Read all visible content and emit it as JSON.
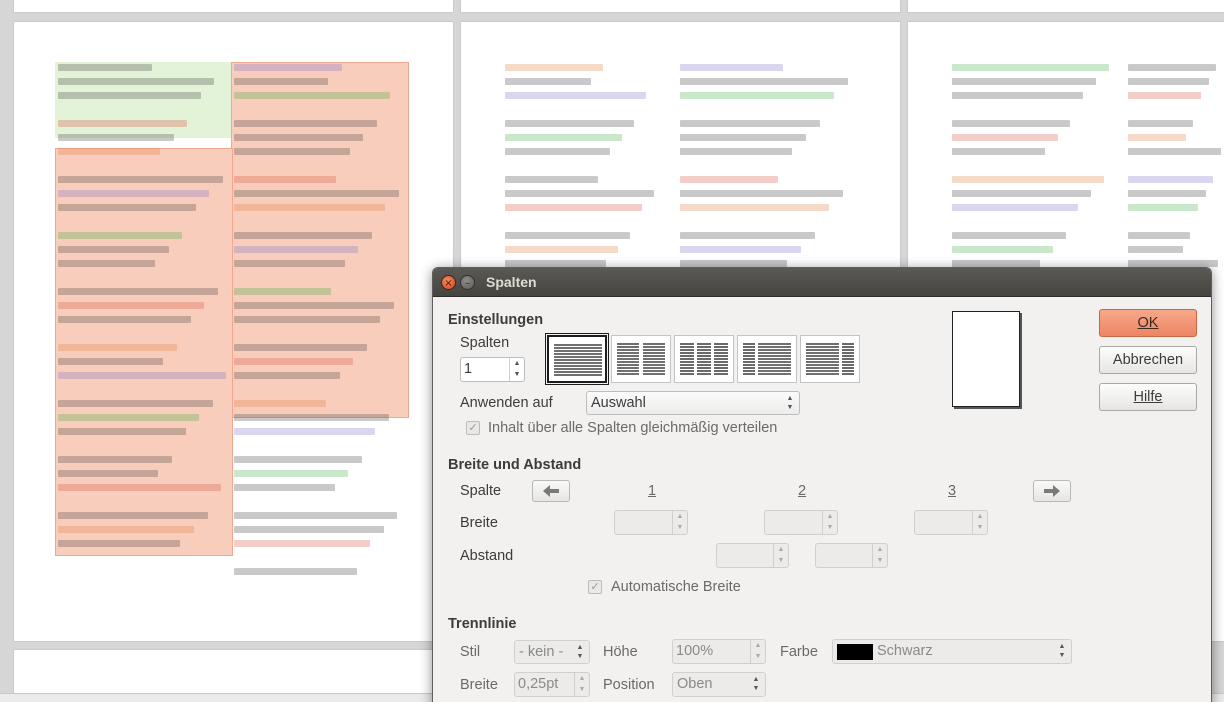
{
  "dialog": {
    "title": "Spalten",
    "sections": {
      "settings": "Einstellungen",
      "width_spacing": "Breite und Abstand",
      "separator": "Trennlinie"
    },
    "settings": {
      "columns_label": "Spalten",
      "columns_value": "1",
      "apply_label": "Anwenden auf",
      "apply_value": "Auswahl",
      "distribute_label": "Inhalt über alle Spalten gleichmäßig verteilen",
      "distribute_checked": true
    },
    "width_spacing": {
      "column_label": "Spalte",
      "width_label": "Breite",
      "spacing_label": "Abstand",
      "column_numbers": [
        "1",
        "2",
        "3"
      ],
      "auto_width_label": "Automatische Breite",
      "auto_width_checked": true
    },
    "separator": {
      "style_label": "Stil",
      "style_value": "- kein -",
      "height_label": "Höhe",
      "height_value": "100%",
      "color_label": "Farbe",
      "color_value": "Schwarz",
      "color_swatch": "#000000",
      "width_label": "Breite",
      "width_value": "0,25pt",
      "position_label": "Position",
      "position_value": "Oben"
    },
    "buttons": {
      "ok": "OK",
      "cancel": "Abbrechen",
      "help": "Hilfe"
    },
    "icons": {
      "close": "×",
      "minimize": "–",
      "spin_up": "▲",
      "spin_down": "▼"
    },
    "accent_color": "#ed8563"
  }
}
